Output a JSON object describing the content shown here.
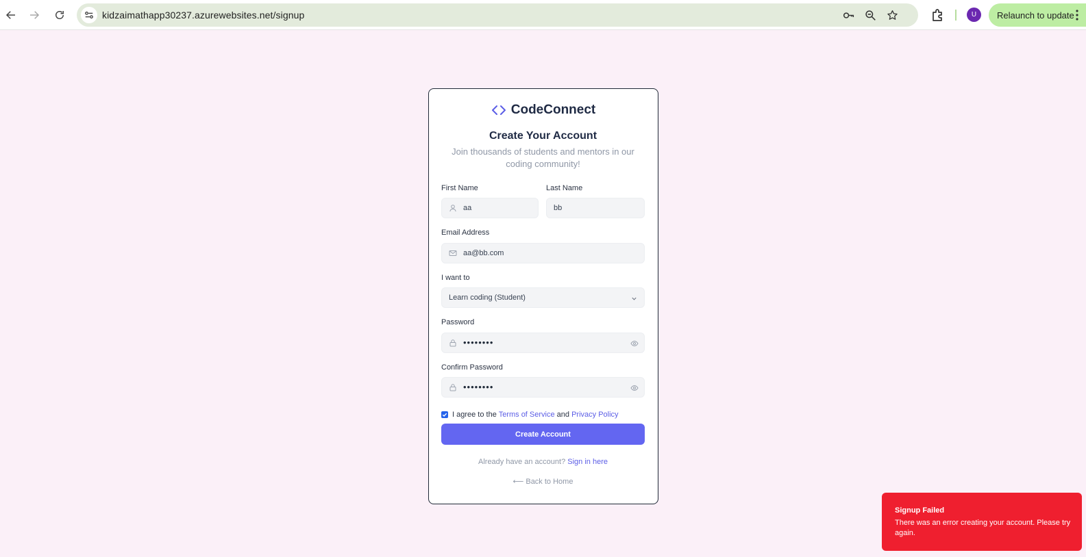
{
  "browser": {
    "url": "kidzaimathapp30237.azurewebsites.net/signup",
    "profile_initial": "U",
    "relaunch_label": "Relaunch to update"
  },
  "brand": {
    "name": "CodeConnect",
    "accent_color": "#5b5de6"
  },
  "form": {
    "title": "Create Your Account",
    "subtitle": "Join thousands of students and mentors in our coding community!",
    "first_name": {
      "label": "First Name",
      "value": "aa"
    },
    "last_name": {
      "label": "Last Name",
      "value": "bb"
    },
    "email": {
      "label": "Email Address",
      "value": "aa@bb.com"
    },
    "role": {
      "label": "I want to",
      "value": "Learn coding (Student)"
    },
    "password": {
      "label": "Password",
      "masked": "••••••••"
    },
    "confirm_password": {
      "label": "Confirm Password",
      "masked": "••••••••"
    },
    "terms": {
      "checked": true,
      "prefix": "I agree to the",
      "terms_link": "Terms of Service",
      "and": "and",
      "privacy_link": "Privacy Policy"
    },
    "submit_label": "Create Account",
    "already_text": "Already have an account?",
    "sign_in_link": "Sign in here",
    "back_home": "⟵ Back to Home"
  },
  "toast": {
    "title": "Signup Failed",
    "description": "There was an error creating your account. Please try again.",
    "color": "#ef1f2f"
  }
}
